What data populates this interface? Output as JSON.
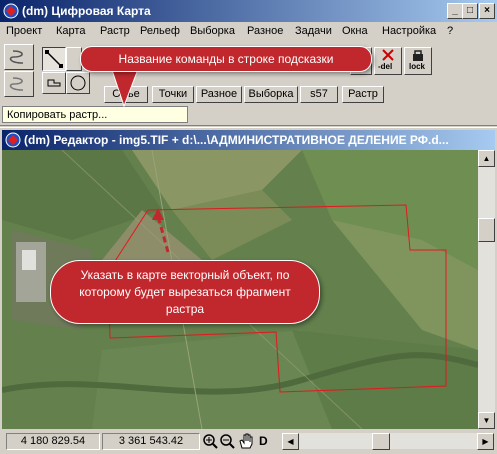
{
  "app": {
    "title": "(dm) Цифровая Карта",
    "window_buttons": [
      "_",
      "□",
      "×"
    ]
  },
  "menu": [
    "Проект",
    "Карта",
    "Растр",
    "Рельеф",
    "Выборка",
    "Разное",
    "Задачи",
    "Окна",
    "Настройка",
    "?"
  ],
  "toolbar": {
    "right_buttons": [
      "-del",
      "lock"
    ],
    "partial_label": "ve"
  },
  "tabs": [
    "Объе",
    "Точки",
    "Разное",
    "Выборка",
    "s57",
    "Растр"
  ],
  "status_hint": "Копировать растр...",
  "callouts": {
    "top": "Название команды в строке подсказки",
    "bottom": "Указать в карте векторный объект, по которому будет вырезаться фрагмент растра"
  },
  "editor": {
    "title": "(dm) Редактор - img5.TIF + d:\\...\\АДМИНИСТРАТИВНОЕ ДЕЛЕНИЕ РФ.d..."
  },
  "statusbar": {
    "coord_x": "4 180 829.54",
    "coord_y": "3 361 543.42",
    "d_label": "D"
  },
  "colors": {
    "callout": "#c0282e",
    "vector_outline": "#e0191e",
    "title_active": "#0a246a",
    "hint_bg": "#ffffe1"
  }
}
